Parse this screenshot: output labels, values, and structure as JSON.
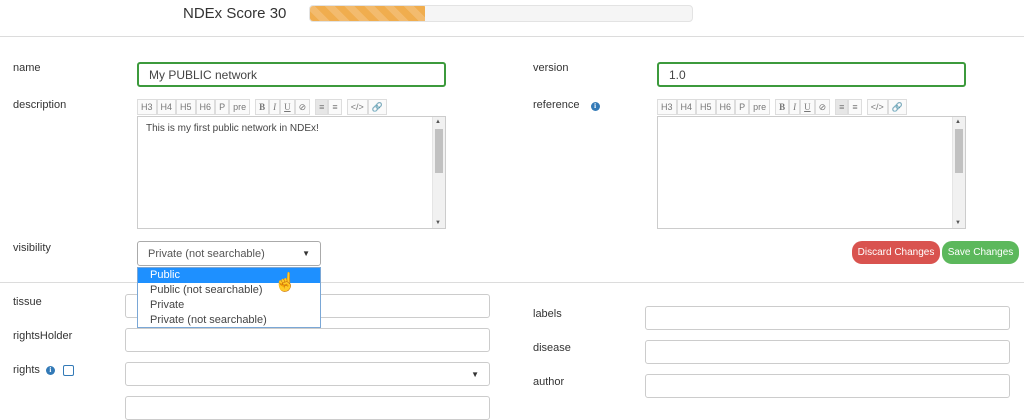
{
  "header": {
    "score_label": "NDEx Score 30",
    "score_value": 30
  },
  "labels": {
    "name": "name",
    "version": "version",
    "description": "description",
    "reference": "reference",
    "visibility": "visibility",
    "tissue": "tissue",
    "rightsHolder": "rightsHolder",
    "rights": "rights",
    "labels": "labels",
    "disease": "disease",
    "author": "author"
  },
  "fields": {
    "name_value": "My PUBLIC network",
    "version_value": "1.0",
    "description_text": "This is my first public network in NDEx!"
  },
  "toolbar": {
    "headings": [
      "H3",
      "H4",
      "H5",
      "H6",
      "P",
      "pre"
    ],
    "format": [
      "B",
      "I",
      "U",
      "⊘"
    ],
    "align": [
      "≡",
      "≡"
    ],
    "code": [
      "</>",
      "🔗"
    ]
  },
  "visibility": {
    "selected": "Private (not searchable)",
    "options": [
      "Public",
      "Public (not searchable)",
      "Private",
      "Private (not searchable)"
    ],
    "highlighted_index": 0
  },
  "buttons": {
    "discard": "Discard Changes",
    "save": "Save Changes"
  },
  "colors": {
    "discard": "#d9534f",
    "save": "#5cb85c",
    "progress": "#f0ad4e",
    "input_focus": "#3c9a3c",
    "info": "#337ab7"
  },
  "icons": {
    "info": "info-icon",
    "edit": "edit-icon",
    "cursor": "hand-pointer-icon"
  }
}
